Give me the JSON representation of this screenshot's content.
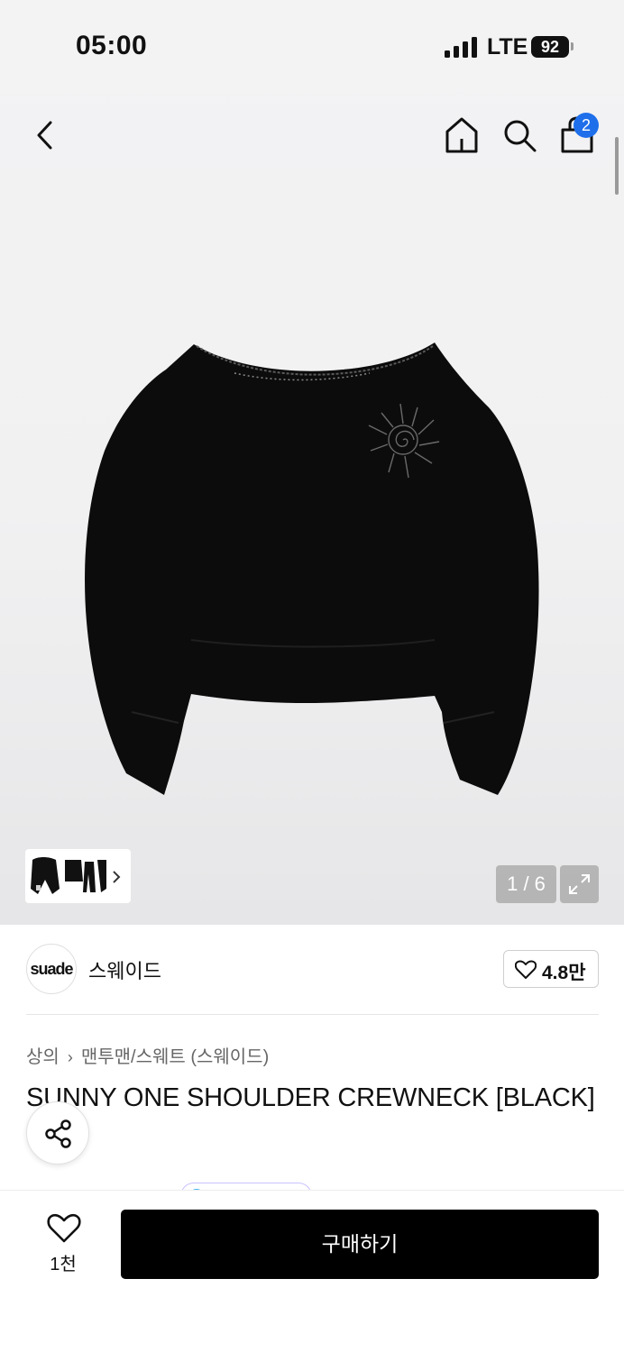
{
  "status_bar": {
    "time": "05:00",
    "network": "LTE",
    "battery": "92"
  },
  "nav": {
    "back_icon": "chevron-left-icon",
    "home_icon": "home-icon",
    "search_icon": "search-icon",
    "cart_icon": "shopping-bag-icon",
    "cart_count": "2"
  },
  "gallery": {
    "counter": "1 / 6",
    "expand_icon": "expand-icon"
  },
  "brand": {
    "logo_text": "suade",
    "name": "스웨이드",
    "likes": "4.8만"
  },
  "breadcrumb": {
    "category": "상의",
    "subcategory": "맨투맨/스웨트 (스웨이드)"
  },
  "product": {
    "title": "SUNNY ONE SHOULDER CREWNECK [BLACK]"
  },
  "bottom_bar": {
    "wish_count": "1천",
    "buy_label": "구매하기"
  },
  "colors": {
    "badge": "#1f6feb",
    "buy_button": "#000000",
    "garment": "#0c0c0c"
  }
}
